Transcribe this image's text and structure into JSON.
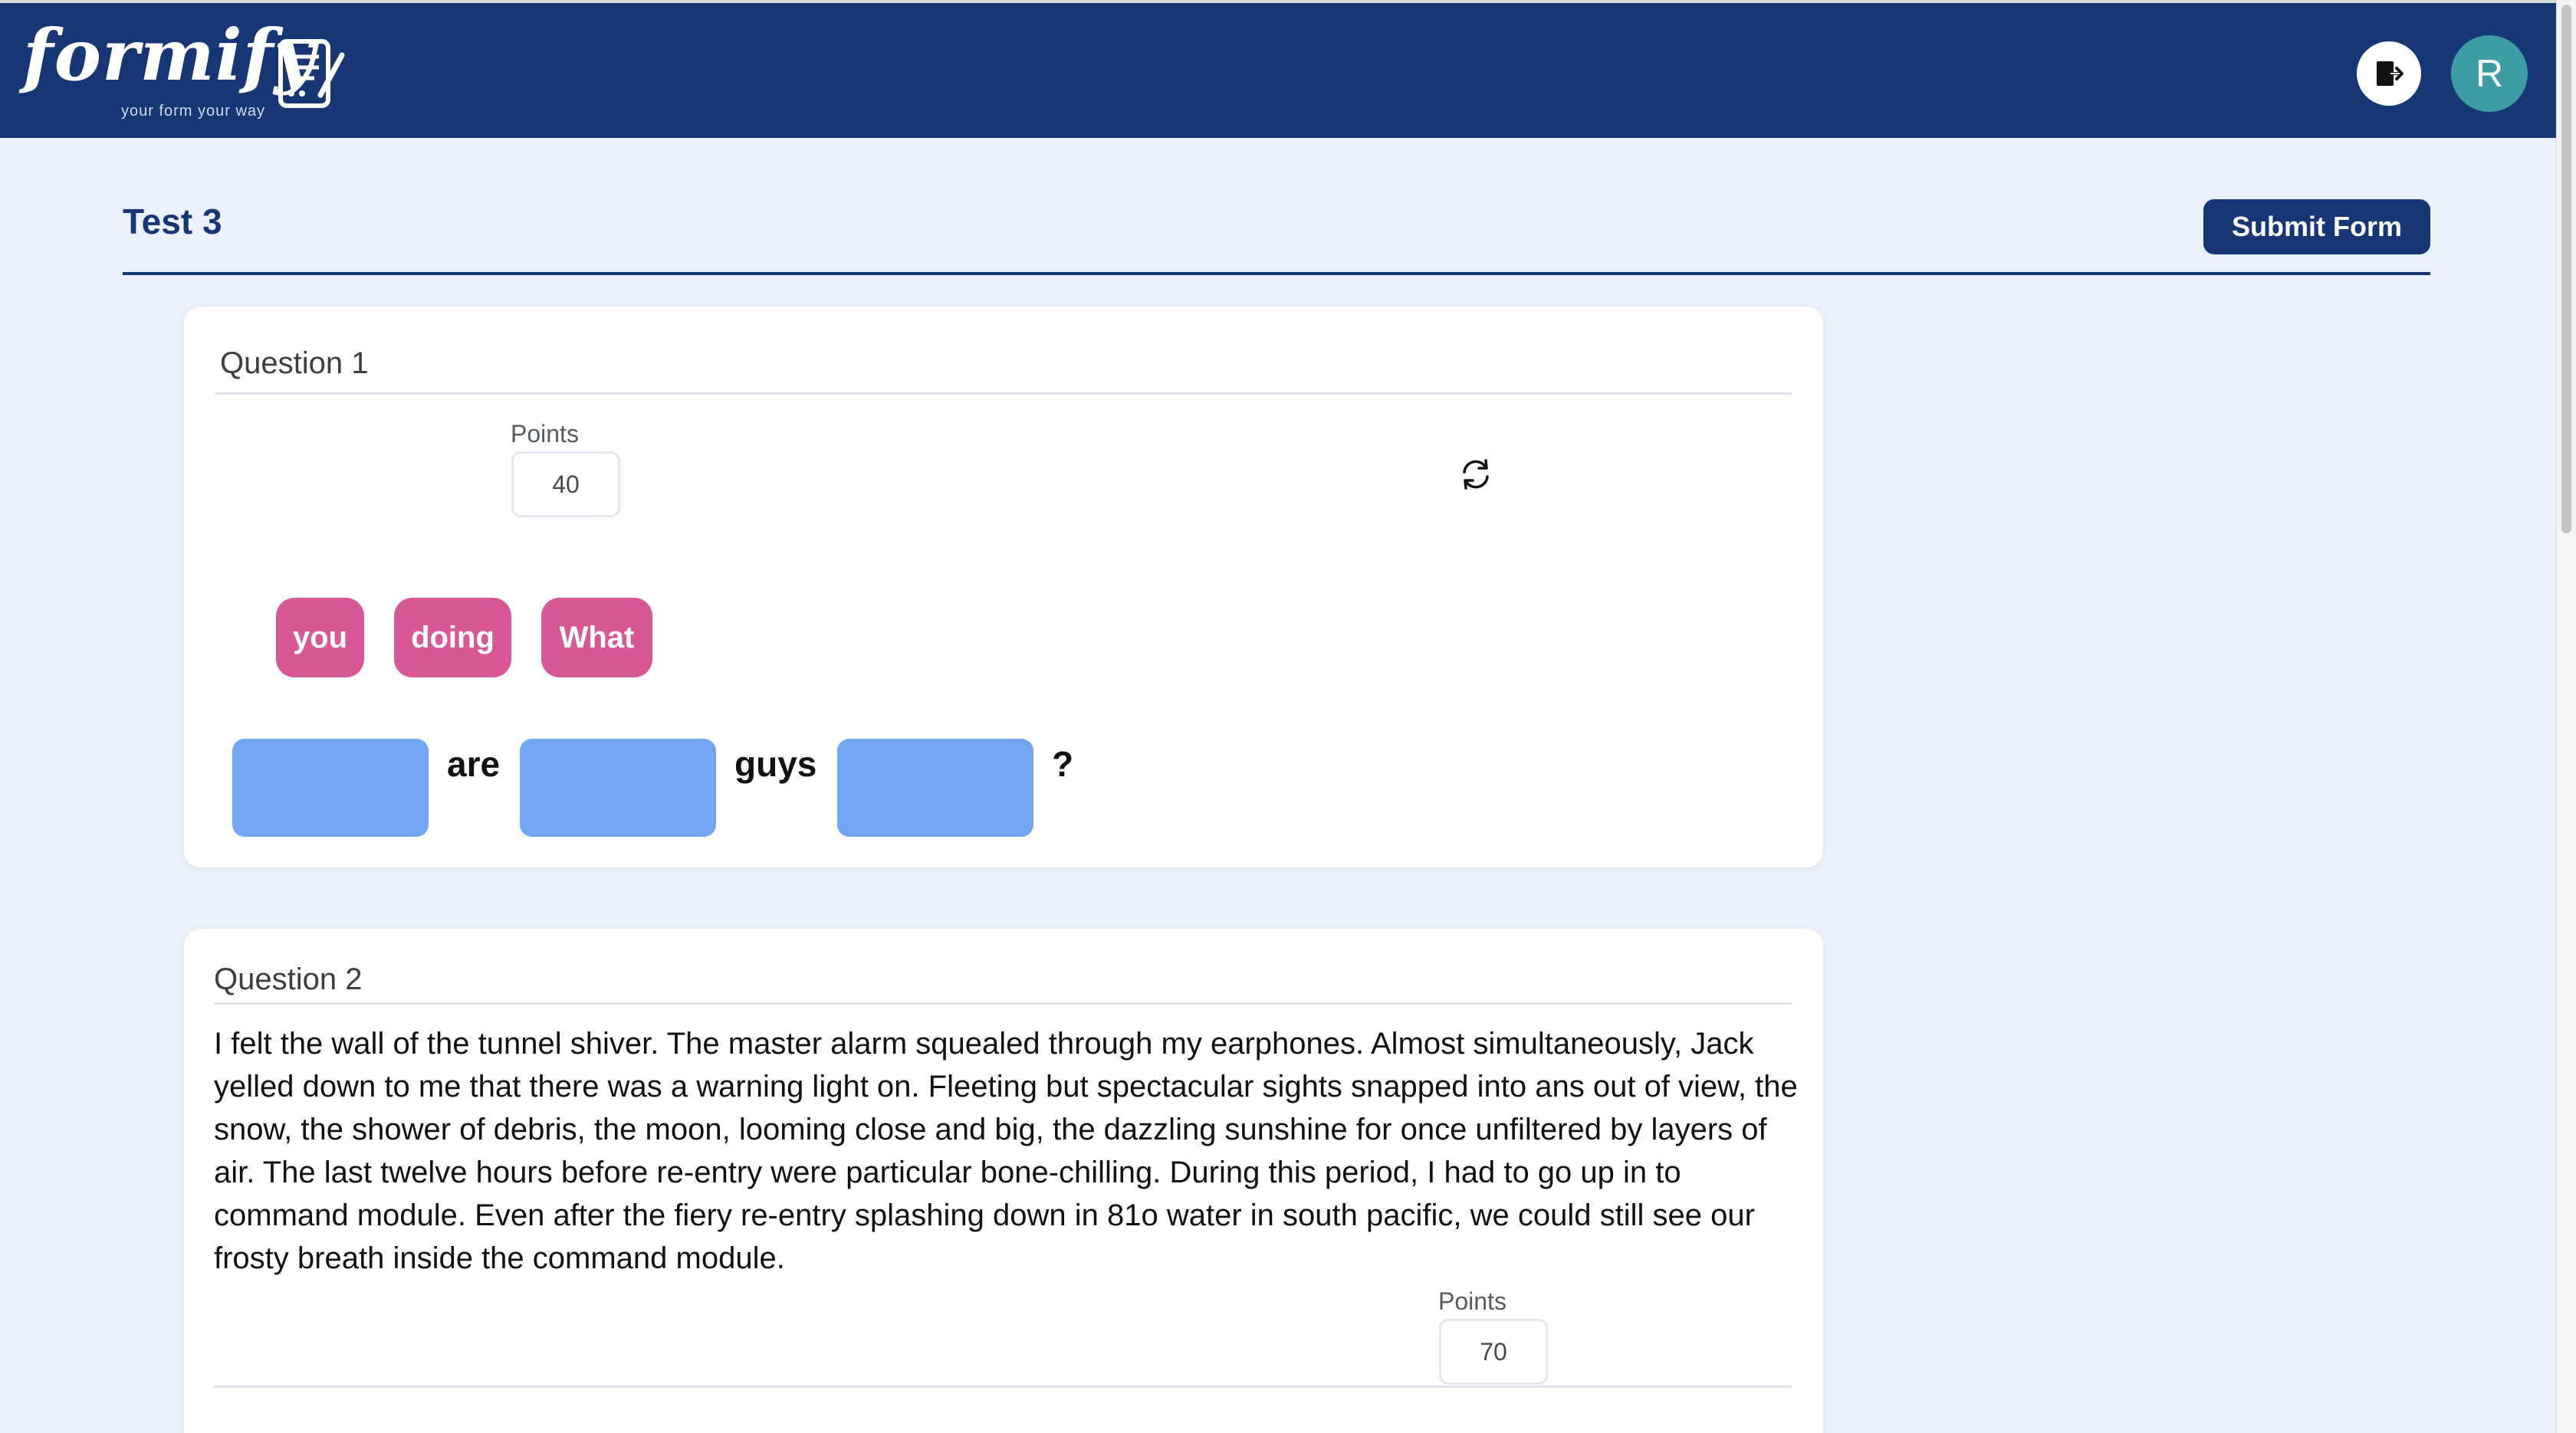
{
  "app": {
    "logo_text": "formify",
    "tagline": "your form your way",
    "avatar_initial": "R"
  },
  "form": {
    "title": "Test 3",
    "submit_label": "Submit Form"
  },
  "questions": [
    {
      "heading": "Question 1",
      "points_label": "Points",
      "points_value": "40",
      "word_chips": [
        "you",
        "doing",
        "What"
      ],
      "sentence_words": [
        "are",
        "guys",
        "?"
      ]
    },
    {
      "heading": "Question 2",
      "passage": "I felt the wall of the tunnel shiver. The master alarm squealed through my earphones. Almost simultaneously, Jack yelled down to me that there was a warning light on. Fleeting but spectacular sights snapped into ans out of view, the snow, the shower of debris, the moon, looming close and big, the dazzling sunshine for once unfiltered by layers of air. The last twelve hours before re-entry were particular bone-chilling. During this period, I had to go up in to command module. Even after the fiery re-entry splashing down in 81o water in south pacific, we could still see our frosty breath inside the command module.",
      "points_label": "Points",
      "points_value": "70"
    }
  ],
  "colors": {
    "navbar": "#173676",
    "page_bg": "#ebf1fb",
    "chip": "#d85796",
    "blank": "#72a5f3",
    "avatar": "#3c9da4"
  },
  "icons": {
    "logout": "logout-icon",
    "refresh": "refresh-icon",
    "logo": "form-document-icon"
  }
}
